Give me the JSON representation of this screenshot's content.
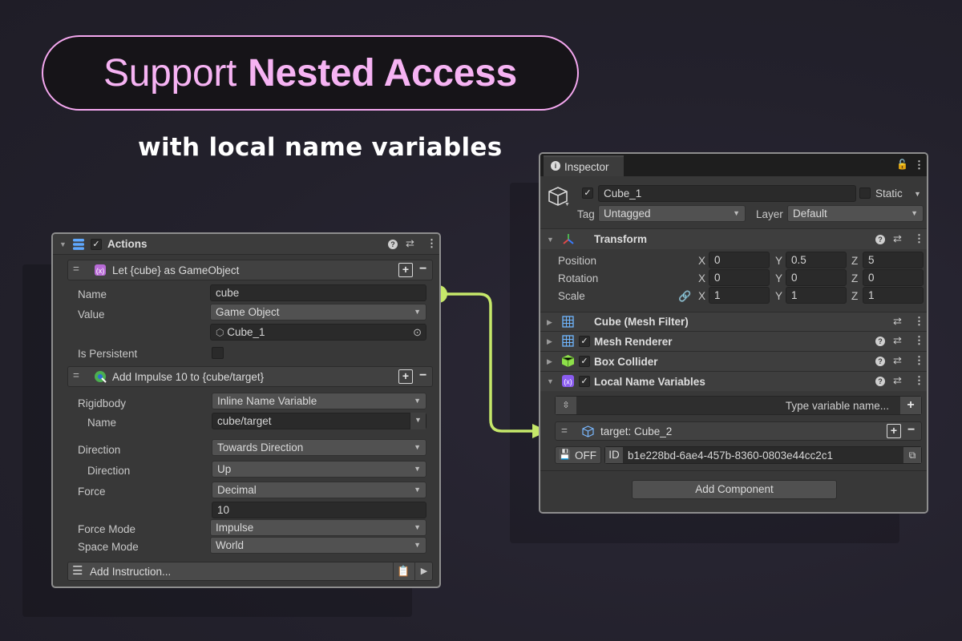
{
  "headline": {
    "part1": "Support",
    "part2": "Nested Access"
  },
  "subtitle": "with local name variables",
  "colors": {
    "accent_pink": "#f5a8f0",
    "connector_green": "#c6e86a",
    "panel_bg": "#383838"
  },
  "actions_panel": {
    "title": "Actions",
    "instruction1": {
      "title": "Let {cube} as GameObject",
      "name_label": "Name",
      "name_value": "cube",
      "value_label": "Value",
      "value_type": "Game Object",
      "object_value": "Cube_1",
      "persistent_label": "Is Persistent"
    },
    "instruction2": {
      "title": "Add Impulse 10 to {cube/target}",
      "rigidbody_label": "Rigidbody",
      "rigidbody_value": "Inline Name Variable",
      "name_label": "Name",
      "name_value": "cube/target",
      "direction_label": "Direction",
      "direction_value": "Towards Direction",
      "sub_direction_label": "Direction",
      "sub_direction_value": "Up",
      "force_label": "Force",
      "force_value": "Decimal",
      "force_number": "10",
      "force_mode_label": "Force Mode",
      "force_mode_value": "Impulse",
      "space_mode_label": "Space Mode",
      "space_mode_value": "World"
    },
    "add_instruction": "Add Instruction..."
  },
  "inspector": {
    "tab": "Inspector",
    "object_name": "Cube_1",
    "static_label": "Static",
    "tag_label": "Tag",
    "tag_value": "Untagged",
    "layer_label": "Layer",
    "layer_value": "Default",
    "transform": {
      "title": "Transform",
      "position_label": "Position",
      "rotation_label": "Rotation",
      "scale_label": "Scale",
      "axis_x": "X",
      "axis_y": "Y",
      "axis_z": "Z",
      "position": [
        "0",
        "0.5",
        "5"
      ],
      "rotation": [
        "0",
        "0",
        "0"
      ],
      "scale": [
        "1",
        "1",
        "1"
      ]
    },
    "components": {
      "mesh_filter": "Cube (Mesh Filter)",
      "mesh_renderer": "Mesh Renderer",
      "box_collider": "Box Collider",
      "local_name_variables": "Local Name Variables"
    },
    "variables": {
      "search_placeholder": "Type variable name...",
      "item_label": "target: Cube_2",
      "off_label": "OFF",
      "id_label": "ID",
      "id_value": "b1e228bd-6ae4-457b-8360-0803e44cc2c1"
    },
    "add_component": "Add Component"
  }
}
